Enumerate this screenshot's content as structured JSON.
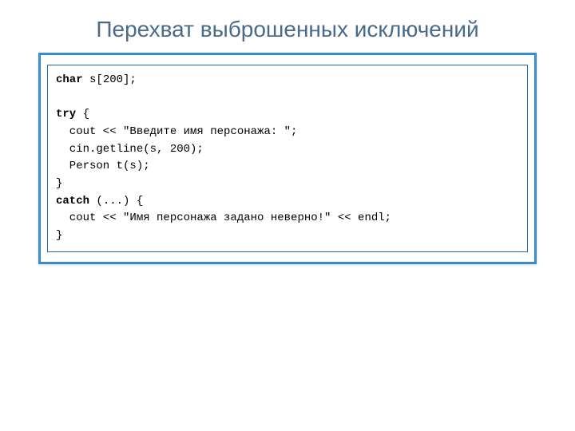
{
  "title": "Перехват выброшенных исключений",
  "code": {
    "l1_kw": "char",
    "l1_rest": " s[200];",
    "l2": "",
    "l3_kw": "try",
    "l3_rest": " {",
    "l4": "  cout << \"Введите имя персонажа: \";",
    "l5": "  cin.getline(s, 200);",
    "l6": "  Person t(s);",
    "l7": "}",
    "l8_kw": "catch",
    "l8_rest": " (...) {",
    "l9": "  cout << \"Имя персонажа задано неверно!\" << endl;",
    "l10": "}"
  }
}
